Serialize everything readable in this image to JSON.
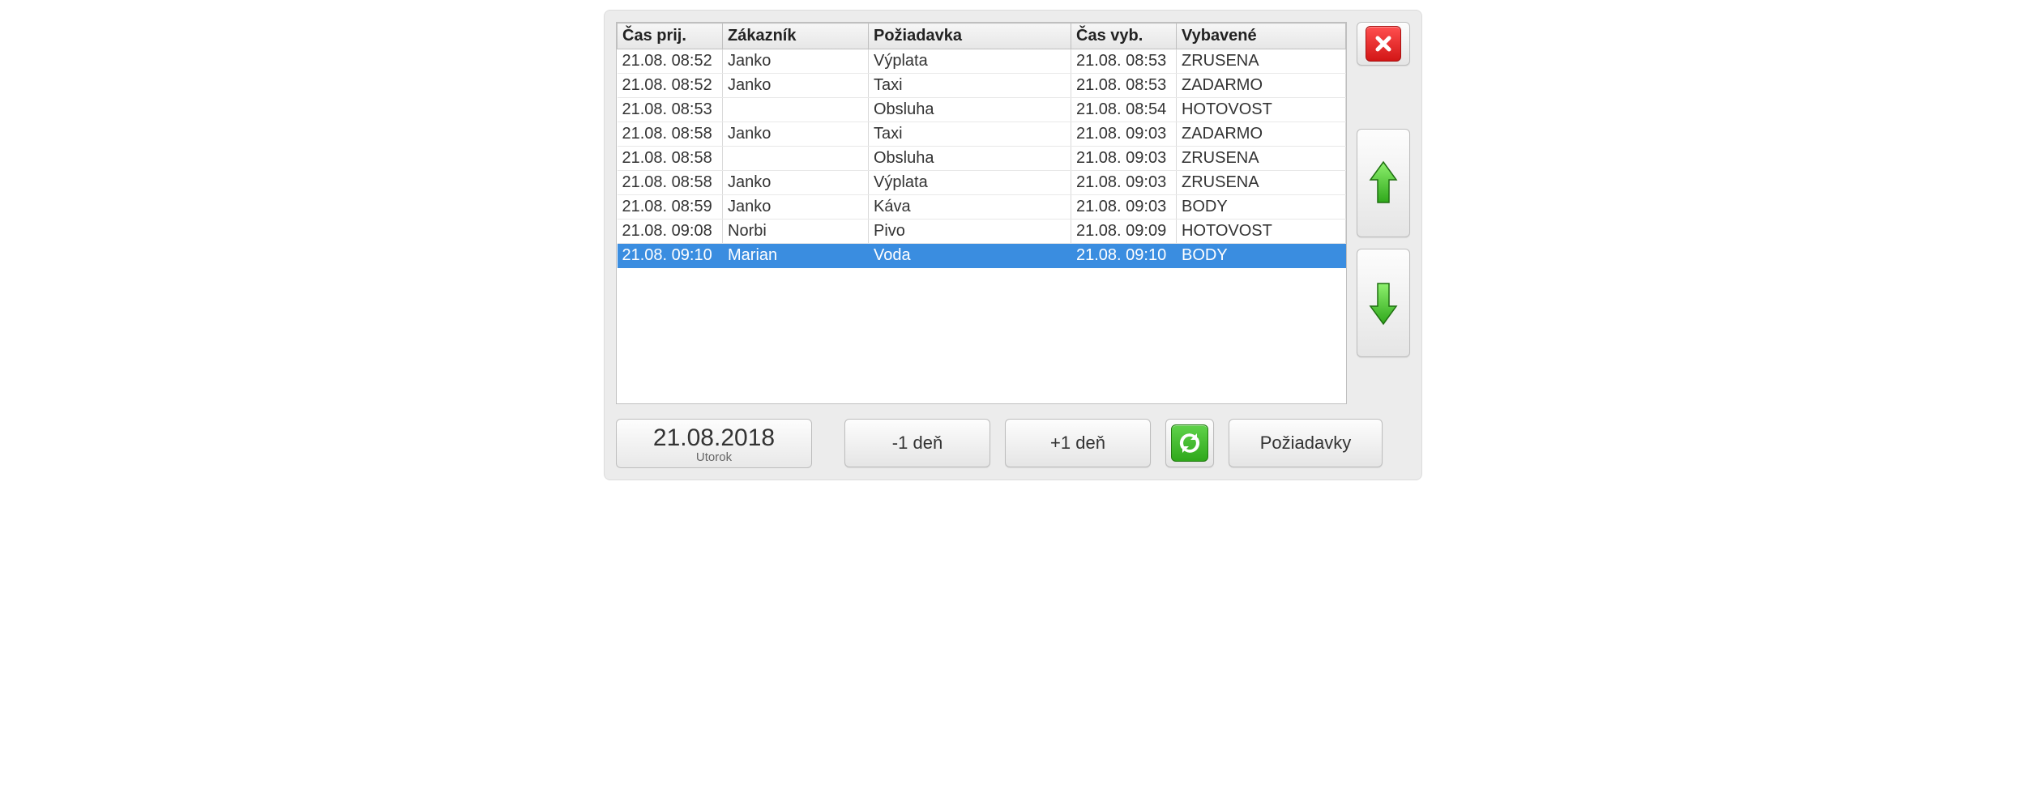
{
  "columns": {
    "c0": "Čas prij.",
    "c1": "Zákazník",
    "c2": "Požiadavka",
    "c3": "Čas vyb.",
    "c4": "Vybavené"
  },
  "rows": [
    {
      "c0": "21.08. 08:52",
      "c1": "Janko",
      "c2": "Výplata",
      "c3": "21.08. 08:53",
      "c4": "ZRUSENA",
      "selected": false
    },
    {
      "c0": "21.08. 08:52",
      "c1": "Janko",
      "c2": "Taxi",
      "c3": "21.08. 08:53",
      "c4": "ZADARMO",
      "selected": false
    },
    {
      "c0": "21.08. 08:53",
      "c1": "",
      "c2": "Obsluha",
      "c3": "21.08. 08:54",
      "c4": "HOTOVOST",
      "selected": false
    },
    {
      "c0": "21.08. 08:58",
      "c1": "Janko",
      "c2": "Taxi",
      "c3": "21.08. 09:03",
      "c4": "ZADARMO",
      "selected": false
    },
    {
      "c0": "21.08. 08:58",
      "c1": "",
      "c2": "Obsluha",
      "c3": "21.08. 09:03",
      "c4": "ZRUSENA",
      "selected": false
    },
    {
      "c0": "21.08. 08:58",
      "c1": "Janko",
      "c2": "Výplata",
      "c3": "21.08. 09:03",
      "c4": "ZRUSENA",
      "selected": false
    },
    {
      "c0": "21.08. 08:59",
      "c1": "Janko",
      "c2": "Káva",
      "c3": "21.08. 09:03",
      "c4": "BODY",
      "selected": false
    },
    {
      "c0": "21.08. 09:08",
      "c1": "Norbi",
      "c2": "Pivo",
      "c3": "21.08. 09:09",
      "c4": "HOTOVOST",
      "selected": false
    },
    {
      "c0": "21.08. 09:10",
      "c1": "Marian",
      "c2": "Voda",
      "c3": "21.08. 09:10",
      "c4": "BODY",
      "selected": true
    }
  ],
  "date": {
    "value": "21.08.2018",
    "weekday": "Utorok"
  },
  "buttons": {
    "minus_day": "-1 deň",
    "plus_day": "+1 deň",
    "requests": "Požiadavky"
  },
  "col_widths": [
    "130px",
    "180px",
    "250px",
    "130px",
    "auto"
  ]
}
